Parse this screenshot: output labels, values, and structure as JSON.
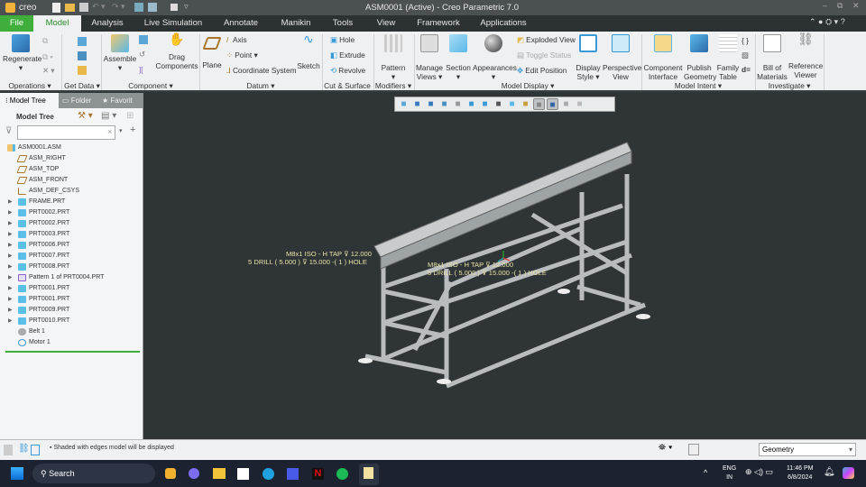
{
  "titlebar": {
    "logo": "creo",
    "title": "ASM0001 (Active) - Creo Parametric 7.0"
  },
  "tabs": [
    "File",
    "Model",
    "Analysis",
    "Live Simulation",
    "Annotate",
    "Manikin",
    "Tools",
    "View",
    "Framework",
    "Applications"
  ],
  "ribbon": {
    "operations": {
      "regenerate": "Regenerate",
      "group": "Operations"
    },
    "get_data": {
      "group": "Get Data"
    },
    "component": {
      "assemble": "Assemble",
      "drag": "Drag Components",
      "group": "Component"
    },
    "datum": {
      "plane": "Plane",
      "axis": "Axis",
      "point": "Point",
      "csys": "Coordinate System",
      "sketch": "Sketch",
      "group": "Datum"
    },
    "cut_surface": {
      "hole": "Hole",
      "extrude": "Extrude",
      "revolve": "Revolve",
      "group": "Cut & Surface"
    },
    "modifiers": {
      "pattern": "Pattern",
      "group": "Modifiers"
    },
    "model_display": {
      "manage_views": "Manage Views",
      "section": "Section",
      "appearances": "Appearances",
      "exploded": "Exploded View",
      "toggle": "Toggle Status",
      "edit_pos": "Edit Position",
      "display_style": "Display Style",
      "perspective": "Perspective View",
      "group": "Model Display"
    },
    "model_intent": {
      "component_interface": "Component Interface",
      "publish": "Publish Geometry",
      "family": "Family Table",
      "group": "Model Intent"
    },
    "investigate": {
      "bom": "Bill of Materials",
      "ref": "Reference Viewer",
      "group": "Investigate"
    }
  },
  "left_panel": {
    "tabs": [
      "Model Tree",
      "Folder",
      "Favorit"
    ],
    "header": "Model Tree",
    "search_placeholder": "",
    "tree": [
      "ASM0001.ASM",
      "ASM_RIGHT",
      "ASM_TOP",
      "ASM_FRONT",
      "ASM_DEF_CSYS",
      "FRAME.PRT",
      "PRT0002.PRT",
      "PRT0002.PRT",
      "PRT0003.PRT",
      "PRT0006.PRT",
      "PRT0007.PRT",
      "PRT0008.PRT",
      "Pattern 1 of PRT0004.PRT",
      "PRT0001.PRT",
      "PRT0001.PRT",
      "PRT0009.PRT",
      "PRT0010.PRT",
      "Belt 1",
      "Motor 1"
    ]
  },
  "annotations": [
    {
      "line1": "M8x1 ISO - H TAP ⊽ 12.000",
      "line2": "5 DRILL ( 5.000 ) ⊽ 15.000  -( 1 ) HOLE"
    },
    {
      "line1": "M8x1 ISO - H TAP ⊽ 12.000",
      "line2": "5 DRILL ( 5.000 ) ⊽ 15.000  -( 1 ) HOLE"
    }
  ],
  "status": {
    "message": "Shaded with edges model will be displayed",
    "filter": "Geometry"
  },
  "taskbar": {
    "search": "Search",
    "lang1": "ENG",
    "lang2": "IN",
    "time": "11:46 PM",
    "date": "6/8/2024"
  }
}
